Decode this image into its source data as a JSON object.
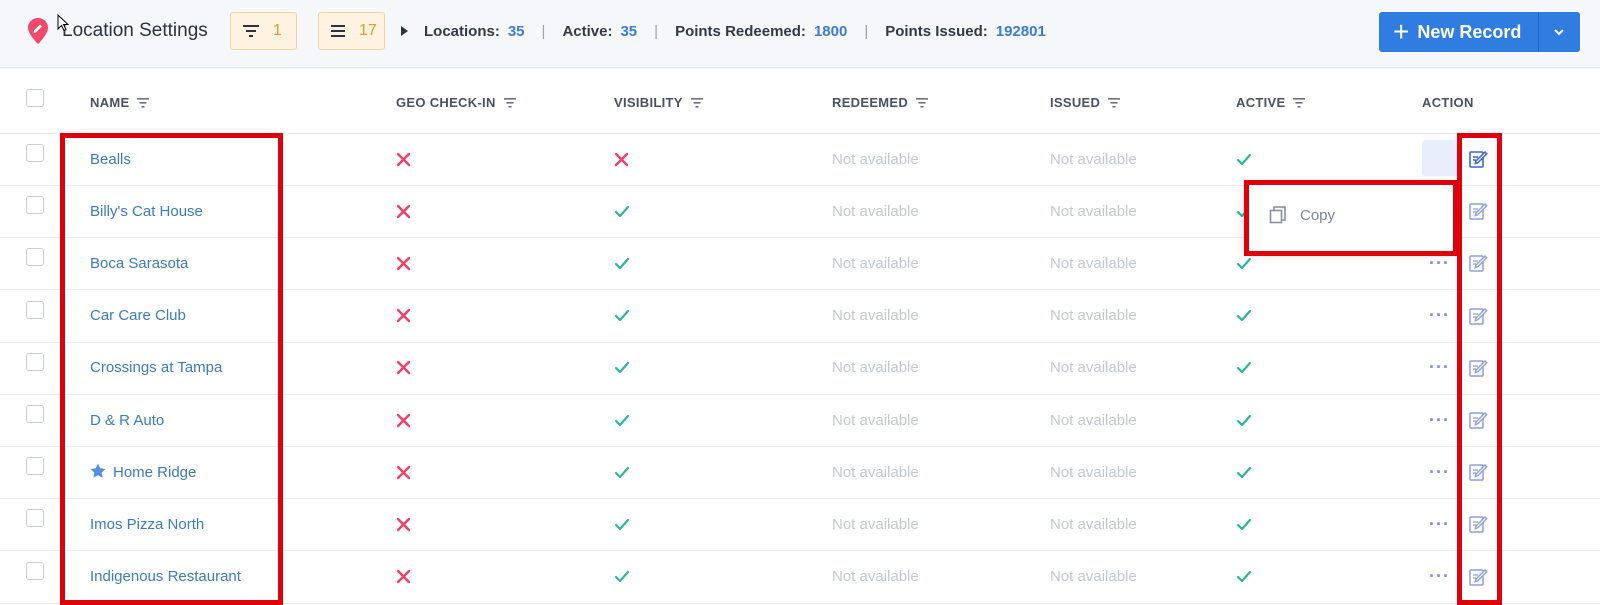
{
  "header": {
    "title": "Location Settings",
    "filter_count": "1",
    "list_count": "17",
    "stats": [
      {
        "label": "Locations:",
        "value": "35"
      },
      {
        "label": "Active:",
        "value": "35"
      },
      {
        "label": "Points Redeemed:",
        "value": "1800"
      },
      {
        "label": "Points Issued:",
        "value": "192801"
      }
    ],
    "new_record_label": "New Record"
  },
  "table": {
    "columns": [
      "NAME",
      "GEO CHECK-IN",
      "VISIBILITY",
      "REDEEMED",
      "ISSUED",
      "ACTIVE",
      "ACTION"
    ],
    "rows": [
      {
        "name": "Bealls",
        "geo_checkin": false,
        "visibility": false,
        "redeemed": "Not available",
        "issued": "Not available",
        "active": true,
        "starred": false
      },
      {
        "name": "Billy's Cat House",
        "geo_checkin": false,
        "visibility": true,
        "redeemed": "Not available",
        "issued": "Not available",
        "active": true,
        "starred": false
      },
      {
        "name": "Boca Sarasota",
        "geo_checkin": false,
        "visibility": true,
        "redeemed": "Not available",
        "issued": "Not available",
        "active": true,
        "starred": false
      },
      {
        "name": "Car Care Club",
        "geo_checkin": false,
        "visibility": true,
        "redeemed": "Not available",
        "issued": "Not available",
        "active": true,
        "starred": false
      },
      {
        "name": "Crossings at Tampa",
        "geo_checkin": false,
        "visibility": true,
        "redeemed": "Not available",
        "issued": "Not available",
        "active": true,
        "starred": false
      },
      {
        "name": "D & R Auto",
        "geo_checkin": false,
        "visibility": true,
        "redeemed": "Not available",
        "issued": "Not available",
        "active": true,
        "starred": false
      },
      {
        "name": "Home Ridge",
        "geo_checkin": false,
        "visibility": true,
        "redeemed": "Not available",
        "issued": "Not available",
        "active": true,
        "starred": true
      },
      {
        "name": "Imos Pizza North",
        "geo_checkin": false,
        "visibility": true,
        "redeemed": "Not available",
        "issued": "Not available",
        "active": true,
        "starred": false
      },
      {
        "name": "Indigenous Restaurant",
        "geo_checkin": false,
        "visibility": true,
        "redeemed": "Not available",
        "issued": "Not available",
        "active": true,
        "starred": false
      }
    ]
  },
  "action_menu": {
    "items": [
      {
        "label": "Copy",
        "icon": "copy-icon"
      }
    ]
  },
  "colors": {
    "accent": "#2f7de1",
    "link": "#3b7bbf",
    "cross": "#ee3f6a",
    "check": "#2bb59a",
    "highlight": "#e0000b"
  }
}
